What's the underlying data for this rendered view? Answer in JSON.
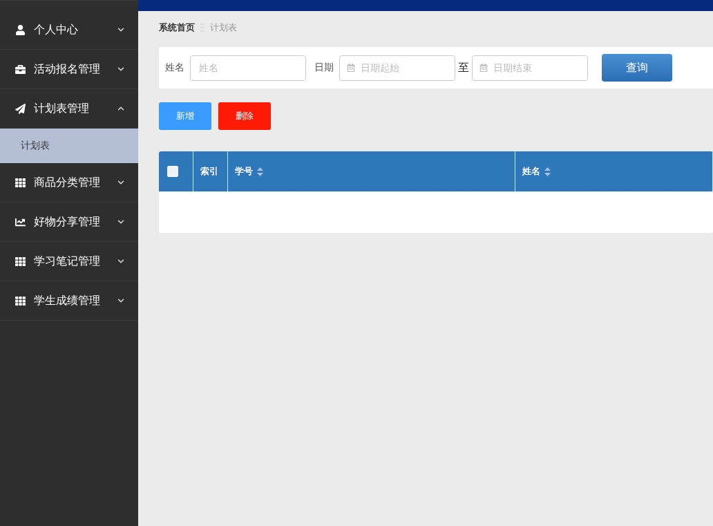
{
  "sidebar": {
    "items": [
      {
        "label": "个人中心",
        "expanded": false
      },
      {
        "label": "活动报名管理",
        "expanded": false
      },
      {
        "label": "计划表管理",
        "expanded": true,
        "children": [
          {
            "label": "计划表",
            "selected": true
          }
        ]
      },
      {
        "label": "商品分类管理",
        "expanded": false
      },
      {
        "label": "好物分享管理",
        "expanded": false
      },
      {
        "label": "学习笔记管理",
        "expanded": false
      },
      {
        "label": "学生成绩管理",
        "expanded": false
      }
    ]
  },
  "breadcrumb": [
    "系统首页",
    "计划表"
  ],
  "search": {
    "name_label": "姓名",
    "name_placeholder": "姓名",
    "date_label": "日期",
    "start_placeholder": "日期起始",
    "to": "至",
    "end_placeholder": "日期结束",
    "button": "查询"
  },
  "actions": [
    {
      "label": "新增",
      "kind": "add"
    },
    {
      "label": "删除",
      "kind": "delete"
    }
  ],
  "table": {
    "checked": false,
    "columns": [
      {
        "label": "索引",
        "sortable": false
      },
      {
        "label": "学号",
        "sortable": true
      },
      {
        "label": "姓名",
        "sortable": true
      }
    ]
  }
}
